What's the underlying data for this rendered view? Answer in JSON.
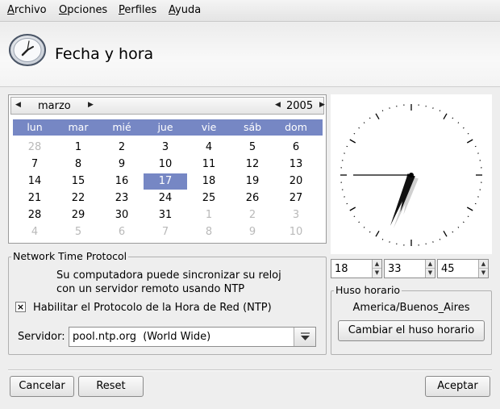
{
  "menu": {
    "items": [
      {
        "accel": "A",
        "rest": "rchivo"
      },
      {
        "accel": "O",
        "rest": "pciones"
      },
      {
        "accel": "P",
        "rest": "erfiles"
      },
      {
        "accel": "A",
        "rest": "yuda"
      }
    ]
  },
  "header": {
    "title": "Fecha y hora",
    "icon": "clock-icon"
  },
  "calendar": {
    "month": "marzo",
    "year": "2005",
    "weekdays": [
      "lun",
      "mar",
      "mié",
      "jue",
      "vie",
      "sáb",
      "dom"
    ],
    "weeks": [
      [
        "28",
        "1",
        "2",
        "3",
        "4",
        "5",
        "6"
      ],
      [
        "7",
        "8",
        "9",
        "10",
        "11",
        "12",
        "13"
      ],
      [
        "14",
        "15",
        "16",
        "17",
        "18",
        "19",
        "20"
      ],
      [
        "21",
        "22",
        "23",
        "24",
        "25",
        "26",
        "27"
      ],
      [
        "28",
        "29",
        "30",
        "31",
        "1",
        "2",
        "3"
      ],
      [
        "4",
        "5",
        "6",
        "7",
        "8",
        "9",
        "10"
      ]
    ],
    "selected": "17",
    "accent_color": "#7687c4"
  },
  "clock": {
    "hour": 18,
    "minute": 33,
    "second": 45
  },
  "time": {
    "hour": "18",
    "minute": "33",
    "second": "45"
  },
  "ntp": {
    "group_title": "Network Time Protocol",
    "description_line1": "Su computadora puede sincronizar su reloj",
    "description_line2": "con un servidor remoto usando NTP",
    "checkbox_label": "Habilitar el Protocolo de la Hora de Red (NTP)",
    "checkbox_checked": true,
    "checkbox_mark": "×",
    "server_label": "Servidor:",
    "server_value": "pool.ntp.org  (World Wide)"
  },
  "timezone": {
    "group_title": "Huso horario",
    "name": "America/Buenos_Aires",
    "change_button": "Cambiar el huso horario"
  },
  "footer": {
    "cancel": "Cancelar",
    "reset": "Reset",
    "accept": "Aceptar"
  }
}
